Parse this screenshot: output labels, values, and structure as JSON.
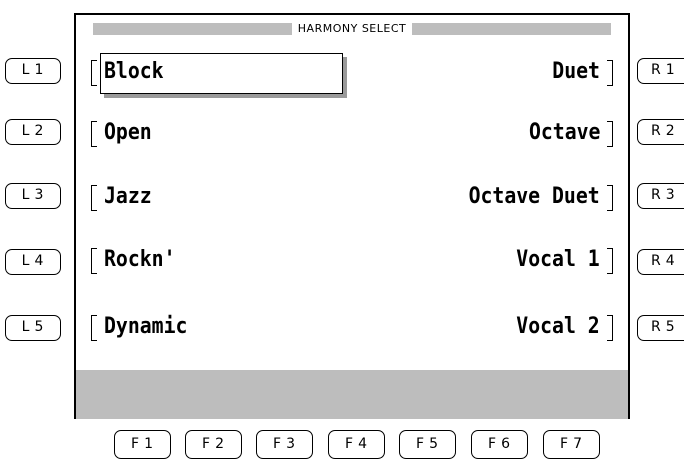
{
  "screen": {
    "title": "HARMONY SELECT",
    "left_items": [
      "Block",
      "Open",
      "Jazz",
      "Rockn'",
      "Dynamic"
    ],
    "right_items": [
      "Duet",
      "Octave",
      "Octave Duet",
      "Vocal 1",
      "Vocal 2"
    ],
    "selected": "Block"
  },
  "side_buttons": {
    "left": [
      "L1",
      "L2",
      "L3",
      "L4",
      "L5"
    ],
    "right": [
      "R1",
      "R2",
      "R3",
      "R4",
      "R5"
    ]
  },
  "function_buttons": [
    "F1",
    "F2",
    "F3",
    "F4",
    "F5",
    "F6",
    "F7"
  ],
  "colors": {
    "band_grey": "#bdbdbd",
    "shadow_grey": "#9a9a9a",
    "ink": "#000000",
    "background": "#ffffff"
  }
}
